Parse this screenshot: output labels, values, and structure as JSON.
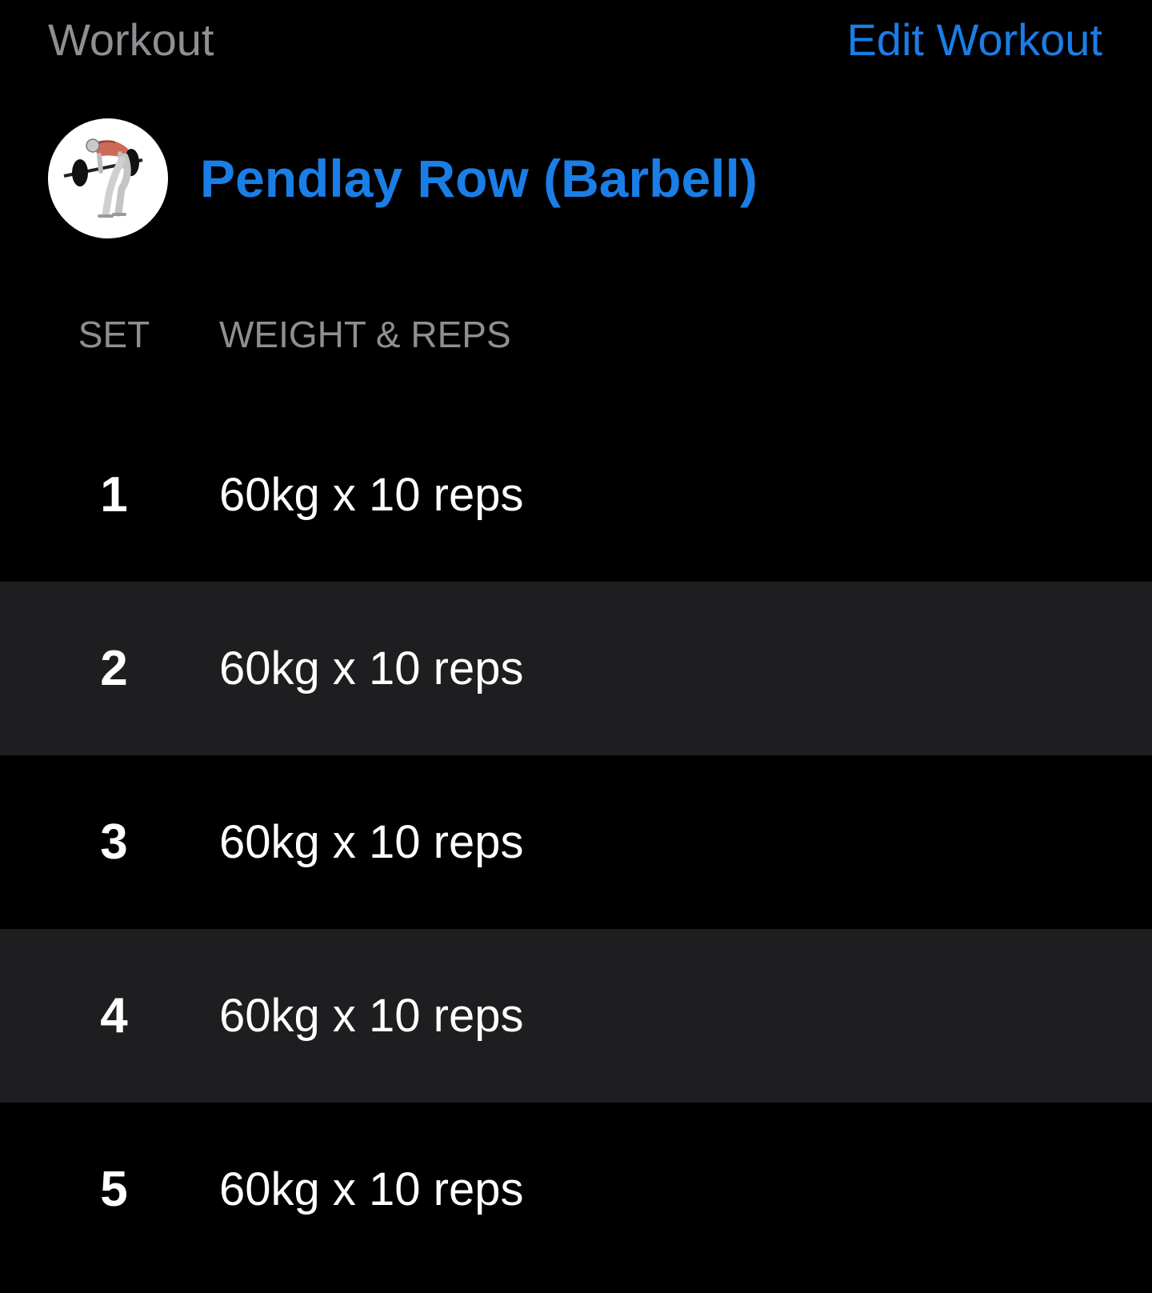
{
  "header": {
    "section_label": "Workout",
    "edit_label": "Edit Workout"
  },
  "exercise": {
    "title": "Pendlay Row (Barbell)",
    "thumbnail_icon": "barbell-row-figure-icon"
  },
  "columns": {
    "set": "SET",
    "weight_reps": "WEIGHT & REPS"
  },
  "sets": [
    {
      "number": "1",
      "value": "60kg x 10 reps"
    },
    {
      "number": "2",
      "value": "60kg x 10 reps"
    },
    {
      "number": "3",
      "value": "60kg x 10 reps"
    },
    {
      "number": "4",
      "value": "60kg x 10 reps"
    },
    {
      "number": "5",
      "value": "60kg x 10 reps"
    }
  ],
  "colors": {
    "background": "#000000",
    "accent": "#1a7ee6",
    "muted_text": "#8e8e93",
    "alt_row": "#1e1e20"
  }
}
